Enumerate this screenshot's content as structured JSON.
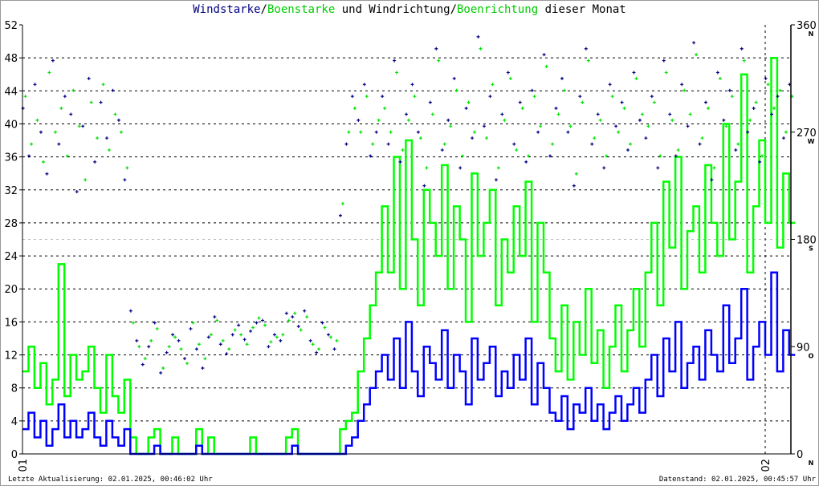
{
  "chart_data": {
    "type": "line",
    "title": {
      "part1": "Windstarke",
      "sep1": "/",
      "part2": "Boenstarke",
      "part3": " und Windrichtung/",
      "part4": "Boenrichtung",
      "part5": " dieser Monat"
    },
    "x_unit": "days since 01 (4 samples per day)",
    "x_step_days": 0.25,
    "x_ticks": [
      {
        "day": 0,
        "label": "01"
      },
      {
        "day": 31,
        "label": "02"
      }
    ],
    "x_range_days": [
      0,
      32.1
    ],
    "y_left": {
      "min": 0,
      "max": 52,
      "step": 4,
      "ticks": [
        "0",
        "4",
        "8",
        "12",
        "16",
        "20",
        "24",
        "28",
        "32",
        "36",
        "40",
        "44",
        "48",
        "52"
      ]
    },
    "y_right": {
      "min": 0,
      "max": 360,
      "ticks": [
        "0",
        "90",
        "180",
        "270",
        "360"
      ],
      "compass": [
        {
          "deg": 360,
          "label": "N"
        },
        {
          "deg": 270,
          "label": "W"
        },
        {
          "deg": 180,
          "label": "S"
        },
        {
          "deg": 90,
          "label": "O"
        },
        {
          "deg": 0,
          "label": "N"
        }
      ]
    },
    "grid": true,
    "colors": {
      "wind": "#0000ff",
      "gust": "#00ff00",
      "wind_dir": "#000080",
      "gust_dir": "#00e000"
    },
    "series": [
      {
        "name": "Windstarke",
        "axis": "left",
        "values": [
          3,
          5,
          2,
          4,
          1,
          3,
          6,
          2,
          4,
          2,
          3,
          5,
          2,
          1,
          4,
          2,
          1,
          3,
          0,
          0,
          0,
          0,
          1,
          0,
          0,
          0,
          0,
          0,
          0,
          1,
          0,
          0,
          0,
          0,
          0,
          0,
          0,
          0,
          0,
          0,
          0,
          0,
          0,
          0,
          0,
          1,
          0,
          0,
          0,
          0,
          0,
          0,
          0,
          0,
          1,
          2,
          4,
          6,
          8,
          10,
          12,
          9,
          14,
          8,
          16,
          10,
          7,
          13,
          11,
          9,
          15,
          8,
          12,
          10,
          6,
          14,
          9,
          11,
          13,
          7,
          10,
          8,
          12,
          9,
          14,
          6,
          11,
          8,
          5,
          4,
          7,
          3,
          6,
          5,
          8,
          4,
          6,
          3,
          5,
          7,
          4,
          6,
          8,
          5,
          9,
          12,
          7,
          14,
          10,
          16,
          8,
          11,
          13,
          9,
          15,
          12,
          10,
          18,
          11,
          14,
          20,
          9,
          13,
          16,
          12,
          22,
          10,
          15,
          12
        ]
      },
      {
        "name": "Boenstarke",
        "axis": "left",
        "values": [
          10,
          13,
          8,
          11,
          6,
          9,
          23,
          7,
          12,
          9,
          10,
          13,
          8,
          5,
          12,
          7,
          5,
          9,
          2,
          0,
          0,
          2,
          3,
          0,
          0,
          2,
          0,
          0,
          0,
          3,
          0,
          2,
          0,
          0,
          0,
          0,
          0,
          0,
          2,
          0,
          0,
          0,
          0,
          0,
          2,
          3,
          0,
          0,
          0,
          0,
          0,
          0,
          0,
          3,
          4,
          5,
          10,
          14,
          18,
          22,
          30,
          22,
          36,
          20,
          38,
          26,
          18,
          32,
          28,
          24,
          35,
          20,
          30,
          26,
          16,
          34,
          24,
          28,
          32,
          18,
          26,
          22,
          30,
          24,
          33,
          16,
          28,
          22,
          14,
          10,
          18,
          9,
          16,
          12,
          20,
          11,
          15,
          8,
          13,
          18,
          10,
          15,
          20,
          13,
          22,
          28,
          18,
          33,
          25,
          36,
          20,
          27,
          30,
          22,
          35,
          28,
          24,
          40,
          26,
          33,
          46,
          22,
          30,
          38,
          28,
          48,
          25,
          34,
          28
        ]
      },
      {
        "name": "Windrichtung",
        "axis": "right",
        "values": [
          290,
          250,
          310,
          270,
          235,
          330,
          260,
          300,
          285,
          220,
          275,
          315,
          245,
          295,
          265,
          305,
          280,
          230,
          120,
          95,
          75,
          90,
          110,
          68,
          85,
          100,
          95,
          80,
          105,
          88,
          72,
          98,
          115,
          92,
          84,
          100,
          108,
          96,
          103,
          110,
          112,
          90,
          100,
          95,
          118,
          115,
          107,
          120,
          95,
          85,
          110,
          100,
          88,
          200,
          260,
          300,
          280,
          310,
          250,
          270,
          300,
          260,
          330,
          245,
          285,
          310,
          270,
          225,
          295,
          340,
          255,
          280,
          315,
          240,
          290,
          265,
          350,
          275,
          300,
          230,
          285,
          320,
          260,
          295,
          245,
          305,
          270,
          335,
          250,
          290,
          315,
          270,
          225,
          300,
          340,
          260,
          285,
          240,
          310,
          275,
          295,
          255,
          320,
          280,
          265,
          300,
          240,
          330,
          285,
          250,
          310,
          275,
          345,
          260,
          295,
          230,
          320,
          280,
          305,
          255,
          340,
          270,
          290,
          245,
          315,
          285,
          300,
          265,
          310
        ]
      },
      {
        "name": "Boenrichtung",
        "axis": "right",
        "values": [
          300,
          260,
          280,
          245,
          320,
          270,
          290,
          250,
          305,
          275,
          230,
          295,
          265,
          310,
          255,
          285,
          270,
          240,
          110,
          90,
          80,
          95,
          105,
          72,
          90,
          98,
          88,
          76,
          110,
          92,
          80,
          100,
          112,
          95,
          88,
          104,
          100,
          92,
          106,
          114,
          108,
          94,
          98,
          100,
          112,
          118,
          104,
          115,
          92,
          88,
          106,
          98,
          95,
          210,
          270,
          290,
          270,
          300,
          260,
          280,
          290,
          270,
          320,
          255,
          280,
          300,
          265,
          240,
          285,
          330,
          260,
          275,
          305,
          250,
          295,
          270,
          340,
          265,
          310,
          240,
          280,
          315,
          255,
          290,
          250,
          300,
          275,
          325,
          260,
          285,
          305,
          275,
          235,
          295,
          330,
          265,
          280,
          250,
          300,
          270,
          290,
          260,
          315,
          285,
          275,
          295,
          250,
          320,
          280,
          255,
          305,
          285,
          335,
          265,
          290,
          240,
          315,
          275,
          300,
          260,
          330,
          280,
          295,
          250,
          310,
          290,
          305,
          270,
          300
        ]
      }
    ]
  },
  "footer": {
    "last_update": "Letzte Aktualisierung: 02.01.2025, 00:46:02 Uhr",
    "data_state": "Datenstand: 02.01.2025, 00:45:57 Uhr"
  }
}
